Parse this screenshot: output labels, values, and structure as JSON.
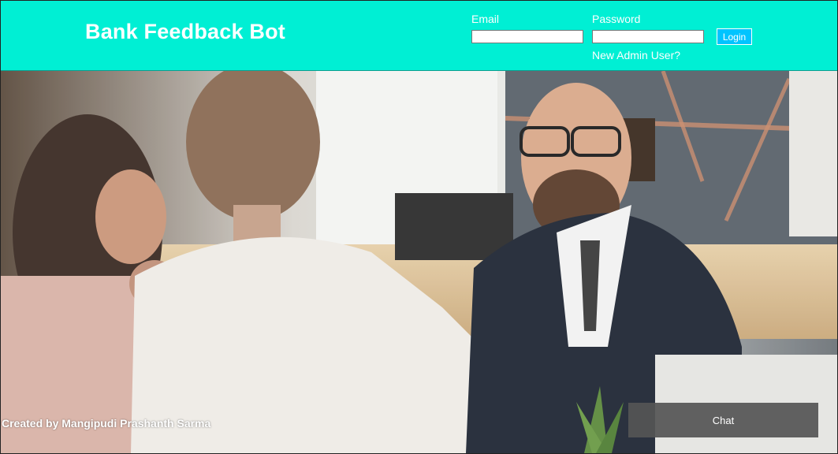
{
  "header": {
    "brand": "Bank Feedback Bot",
    "email_label": "Email",
    "email_value": "",
    "password_label": "Password",
    "password_value": "",
    "login_label": "Login",
    "new_admin_link": "New Admin User?"
  },
  "footer": {
    "credit": "Created by Mangipudi Prashanth Sarma",
    "chat_label": "Chat"
  },
  "colors": {
    "header_bg": "#00efd4",
    "login_bg": "#00c4ff",
    "chat_bg": "#555555"
  }
}
